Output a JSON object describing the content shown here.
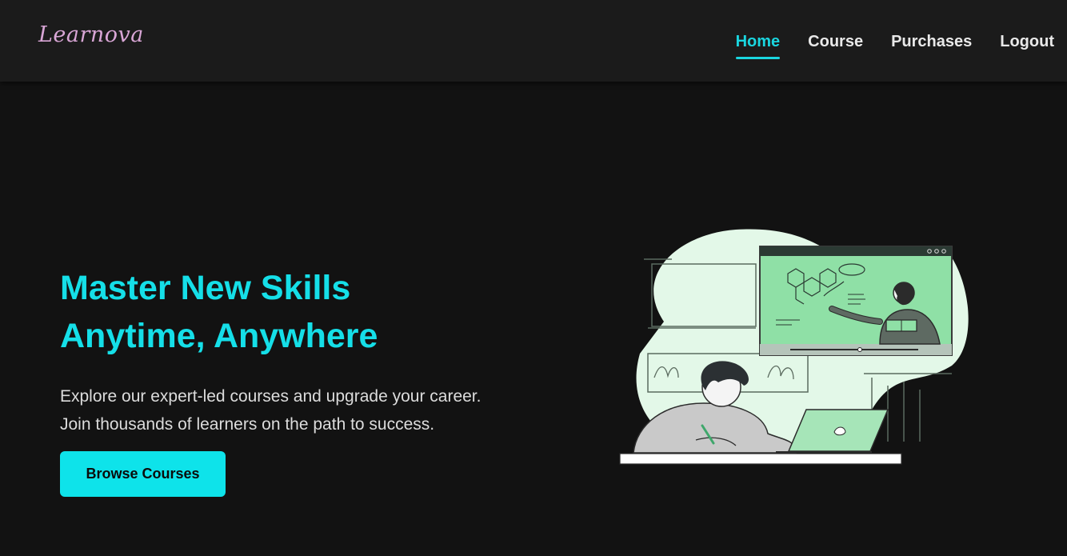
{
  "brand": {
    "logo_text": "Learnova"
  },
  "nav": {
    "items": [
      {
        "label": "Home",
        "active": true
      },
      {
        "label": "Course",
        "active": false
      },
      {
        "label": "Purchases",
        "active": false
      },
      {
        "label": "Logout",
        "active": false
      }
    ]
  },
  "hero": {
    "headline_line1": "Master New Skills",
    "headline_line2": "Anytime, Anywhere",
    "sub_line1": "Explore our expert-led courses and upgrade your career.",
    "sub_line2": "Join thousands of learners on the path to success.",
    "cta_label": "Browse Courses"
  },
  "colors": {
    "accent": "#15dfe8",
    "background": "#121212",
    "navbar": "#1b1b1b",
    "logo": "#d9a6d6",
    "illustration_green": "#8fe0a6",
    "illustration_blob": "#e3f8e8"
  }
}
